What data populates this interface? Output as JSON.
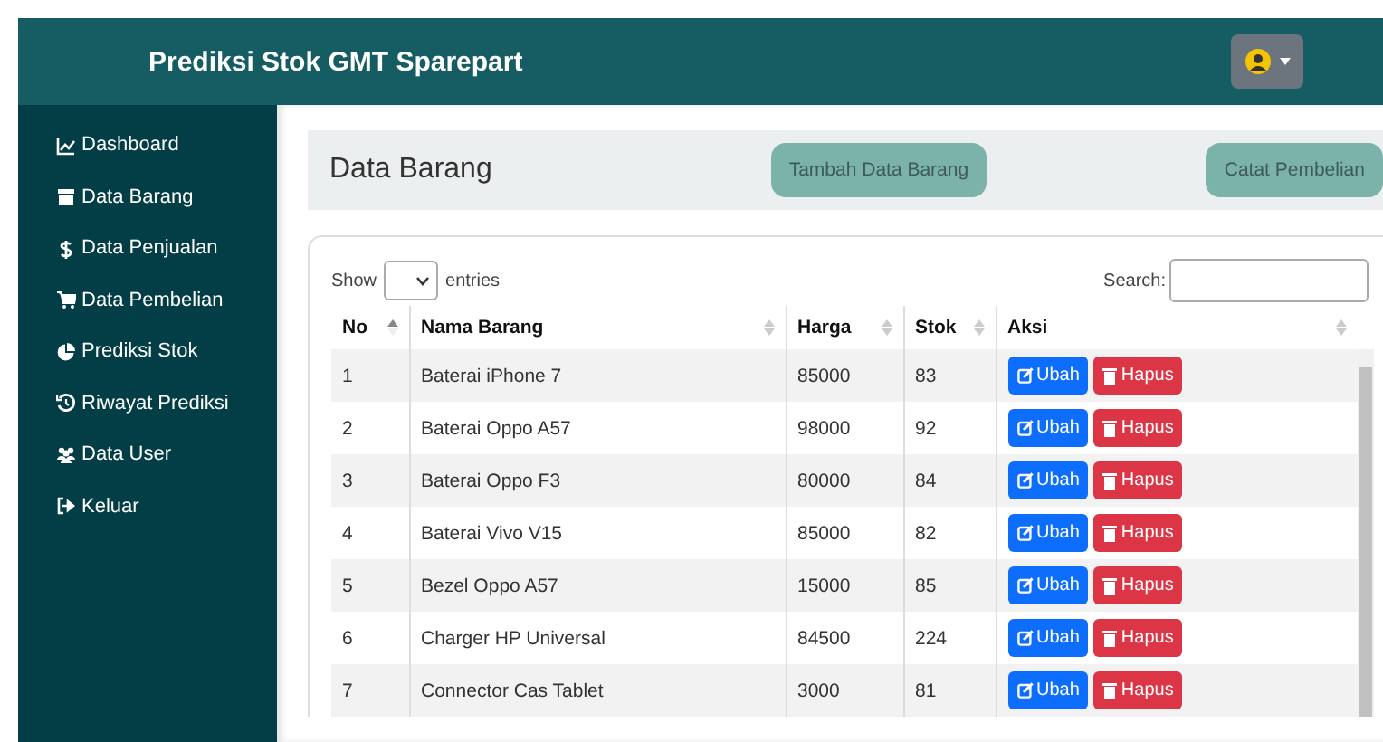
{
  "header": {
    "title": "Prediksi Stok GMT Sparepart"
  },
  "sidebar": {
    "items": [
      {
        "label": "Dashboard",
        "kind": "chart"
      },
      {
        "label": "Data Barang",
        "kind": "box"
      },
      {
        "label": "Data Penjualan",
        "kind": "dollar"
      },
      {
        "label": "Data Pembelian",
        "kind": "cart"
      },
      {
        "label": "Prediksi Stok",
        "kind": "pie"
      },
      {
        "label": "Riwayat Prediksi",
        "kind": "history"
      },
      {
        "label": "Data User",
        "kind": "users"
      },
      {
        "label": "Keluar",
        "kind": "logout"
      }
    ]
  },
  "page": {
    "title": "Data Barang",
    "buttons": [
      "Tambah Data Barang",
      "Catat Pembelian"
    ]
  },
  "table": {
    "show_label": "Show",
    "entries_label": "entries",
    "search_label": "Search:",
    "columns": [
      {
        "label": "No",
        "sorted": true
      },
      {
        "label": "Nama Barang",
        "sorted": false
      },
      {
        "label": "Harga",
        "sorted": false
      },
      {
        "label": "Stok",
        "sorted": false
      },
      {
        "label": "Aksi",
        "sorted": false
      }
    ],
    "rows": [
      {
        "no": "1",
        "name": "Baterai iPhone 7",
        "price": "85000",
        "stock": "83",
        "actions": [
          "Ubah",
          "Hapus"
        ]
      },
      {
        "no": "2",
        "name": "Baterai Oppo A57",
        "price": "98000",
        "stock": "92",
        "actions": [
          "Ubah",
          "Hapus"
        ]
      },
      {
        "no": "3",
        "name": "Baterai Oppo F3",
        "price": "80000",
        "stock": "84",
        "actions": [
          "Ubah",
          "Hapus"
        ]
      },
      {
        "no": "4",
        "name": "Baterai Vivo V15",
        "price": "85000",
        "stock": "82",
        "actions": [
          "Ubah",
          "Hapus"
        ]
      },
      {
        "no": "5",
        "name": "Bezel Oppo A57",
        "price": "15000",
        "stock": "85",
        "actions": [
          "Ubah",
          "Hapus"
        ]
      },
      {
        "no": "6",
        "name": "Charger HP Universal",
        "price": "84500",
        "stock": "224",
        "actions": [
          "Ubah",
          "Hapus"
        ]
      },
      {
        "no": "7",
        "name": "Connector Cas Tablet",
        "price": "3000",
        "stock": "81",
        "actions": [
          "Ubah",
          "Hapus"
        ]
      }
    ]
  }
}
